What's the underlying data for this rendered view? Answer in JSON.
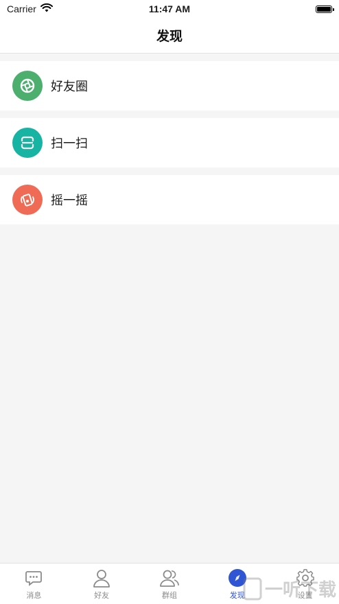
{
  "status_bar": {
    "carrier": "Carrier",
    "time": "11:47 AM"
  },
  "nav": {
    "title": "发现"
  },
  "list": [
    {
      "label": "好友圈",
      "icon": "aperture-icon",
      "color": "#4caf6e"
    },
    {
      "label": "扫一扫",
      "icon": "scan-icon",
      "color": "#17b3a3"
    },
    {
      "label": "摇一摇",
      "icon": "shake-hand-icon",
      "color": "#ef6b55"
    }
  ],
  "tabs": [
    {
      "label": "消息",
      "icon": "chat-icon",
      "active": false
    },
    {
      "label": "好友",
      "icon": "person-icon",
      "active": false
    },
    {
      "label": "群组",
      "icon": "group-icon",
      "active": false
    },
    {
      "label": "发现",
      "icon": "compass-icon",
      "active": true
    },
    {
      "label": "设置",
      "icon": "gear-icon",
      "active": false
    }
  ],
  "colors": {
    "accent": "#2f55d4",
    "background": "#f5f5f5"
  },
  "watermark": "一听下载"
}
